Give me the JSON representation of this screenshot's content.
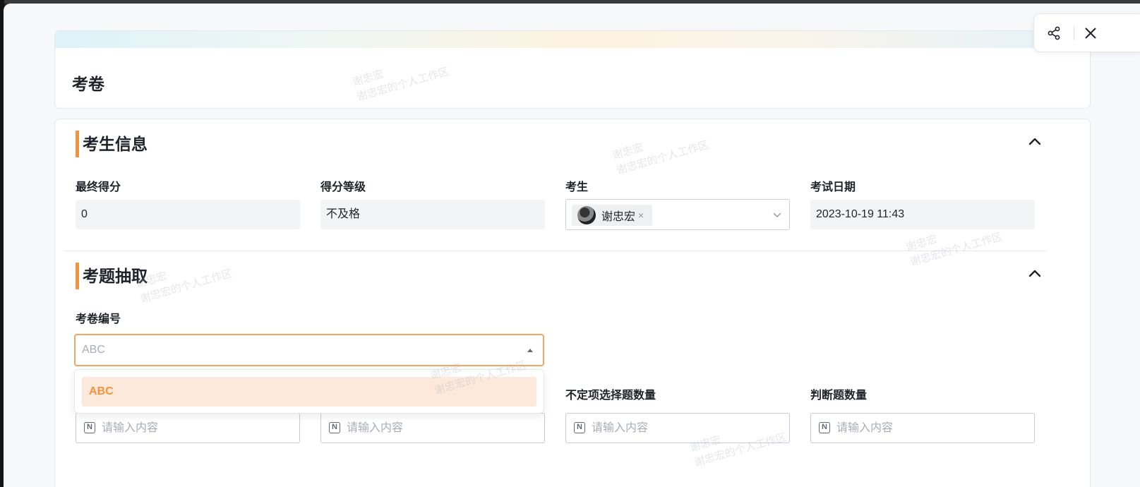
{
  "header": {
    "title": "考卷"
  },
  "sections": {
    "candidate": {
      "title": "考生信息",
      "fields": {
        "final_score_label": "最终得分",
        "final_score_value": "0",
        "grade_label": "得分等级",
        "grade_value": "不及格",
        "examinee_label": "考生",
        "examinee_name": "谢忠宏",
        "exam_date_label": "考试日期",
        "exam_date_value": "2023-10-19 11:43"
      }
    },
    "question_draw": {
      "title": "考题抽取",
      "paper_no_label": "考卷编号",
      "paper_no_placeholder": "ABC",
      "dropdown_options": [
        "ABC"
      ],
      "indeterminate_count_label": "不定项选择题数量",
      "true_false_count_label": "判断题数量",
      "input_placeholder": "请输入内容"
    }
  },
  "watermark": {
    "line1": "谢忠宏",
    "line2": "谢忠宏的个人工作区"
  },
  "colors": {
    "accent": "#f5923e",
    "dropdown_highlight": "#fde9dc"
  },
  "icons": {
    "share": "share-icon",
    "close": "close-icon",
    "collapse": "chevron-up-icon",
    "select_arrow": "chevron-down-icon",
    "number_input": "number-icon"
  }
}
